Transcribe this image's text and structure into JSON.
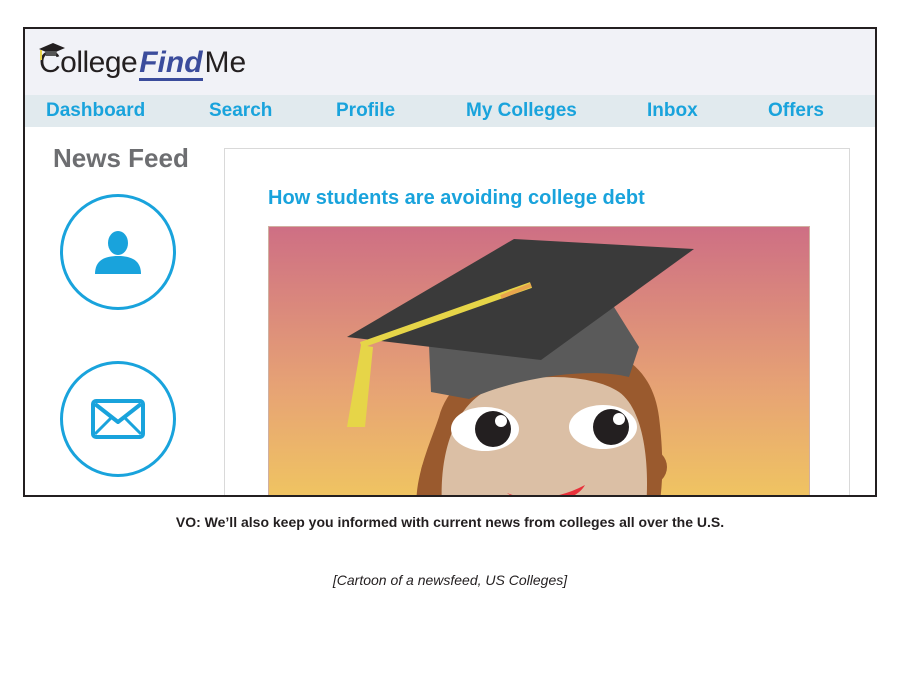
{
  "app": {
    "logo": {
      "part1": "College",
      "part2": "Find",
      "part3": "Me"
    }
  },
  "nav": {
    "items": [
      {
        "label": "Dashboard"
      },
      {
        "label": "Search"
      },
      {
        "label": "Profile"
      },
      {
        "label": "My Colleges"
      },
      {
        "label": "Inbox"
      },
      {
        "label": "Offers"
      }
    ]
  },
  "sidebar": {
    "title": "News Feed",
    "buttons": [
      {
        "icon": "user-icon"
      },
      {
        "icon": "envelope-icon"
      }
    ]
  },
  "feed": {
    "article": {
      "title": "How students are avoiding college debt",
      "image": "graduate-cartoon"
    }
  },
  "caption": {
    "voiceover": "VO: We’ll also keep you informed with current news from colleges all over the U.S.",
    "note": "[Cartoon of a newsfeed, US Colleges]"
  },
  "colors": {
    "accent": "#19a3dc",
    "brand": "#3b4c9c",
    "header_bg": "#f1f2f7",
    "nav_bg": "#e1eaee",
    "muted_text": "#6d6e71"
  }
}
